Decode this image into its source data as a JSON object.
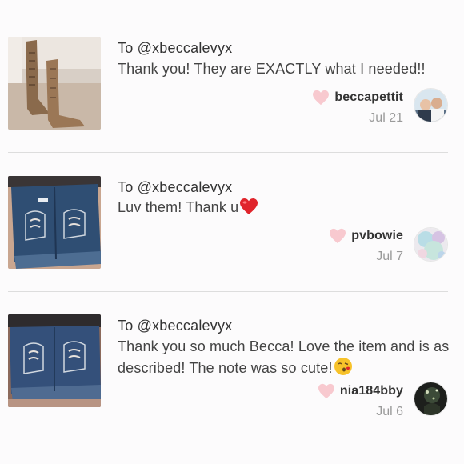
{
  "reviews": [
    {
      "to_prefix": "To ",
      "to_handle": "@xbeccalevyx",
      "message": "Thank you! They are EXACTLY what I needed!!",
      "emoji": "",
      "username": "beccapettit",
      "date": "Jul 21",
      "thumb_icon": "boots-photo",
      "avatar_icon": "user-avatar"
    },
    {
      "to_prefix": "To ",
      "to_handle": "@xbeccalevyx",
      "message": "Luv them! Thank u",
      "emoji": "red-heart-emoji",
      "username": "pvbowie",
      "date": "Jul 7",
      "thumb_icon": "shorts-photo",
      "avatar_icon": "user-avatar"
    },
    {
      "to_prefix": "To ",
      "to_handle": "@xbeccalevyx",
      "message": "Thank you so much Becca! Love the item and is as described! The note was so cute!",
      "emoji": "kiss-face-emoji",
      "username": "nia184bby",
      "date": "Jul 6",
      "thumb_icon": "shorts-photo",
      "avatar_icon": "user-avatar"
    }
  ],
  "colors": {
    "heart": "#f8c9cf",
    "divider": "#dddddd",
    "date": "#9a9a9a"
  }
}
